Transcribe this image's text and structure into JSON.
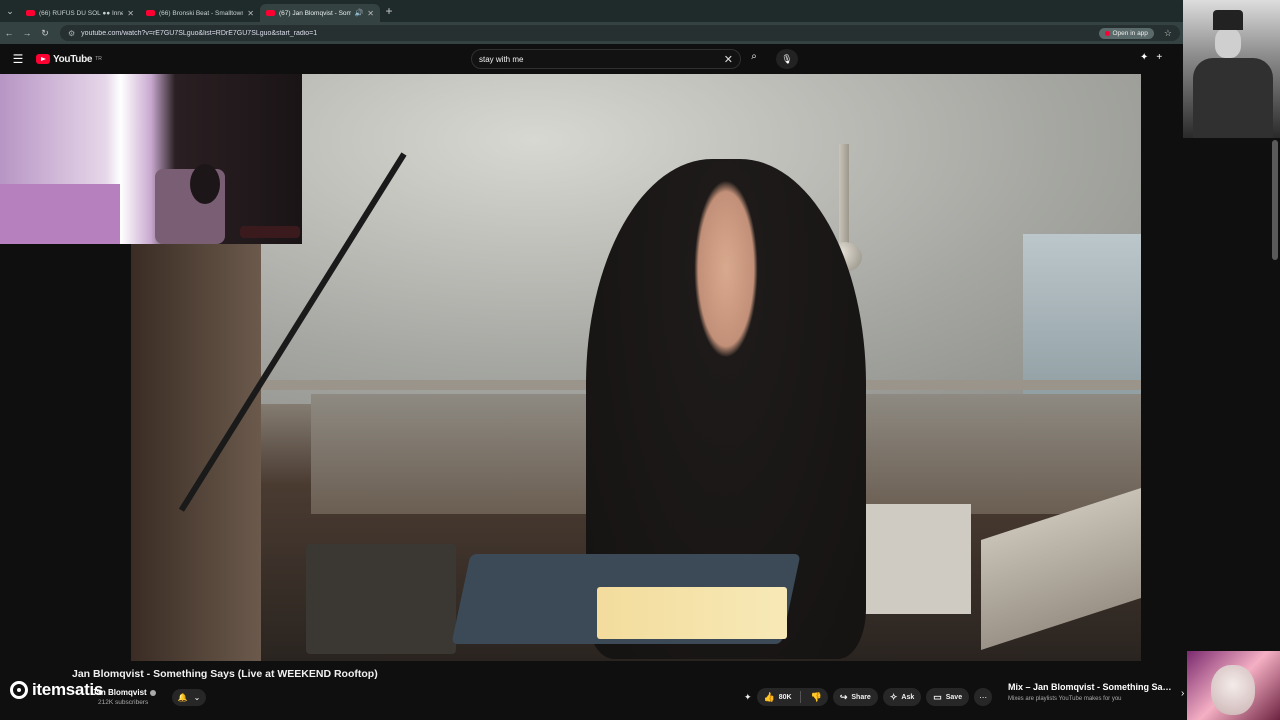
{
  "browser": {
    "tabs": [
      {
        "title": "(66) RÜFÜS DU SOL ●● Innerbloom",
        "active": false
      },
      {
        "title": "(66) Bronski Beat - Smalltown Boy",
        "active": false
      },
      {
        "title": "(67) Jan Blomqvist - Something Says",
        "active": true
      }
    ],
    "url": "youtube.com/watch?v=rE7GU7SLguo&list=RDrE7GU7SLguo&start_radio=1",
    "open_in_app_label": "Open in app"
  },
  "youtube": {
    "logo_text": "YouTube",
    "country_code": "TR",
    "search_query": "stay with me"
  },
  "video": {
    "title": "Jan Blomqvist - Something Says (Live at WEEKEND Rooftop)",
    "channel_name": "Jan Blomqvist",
    "subscribers": "212K subscribers",
    "likes": "80K",
    "share_label": "Share",
    "ask_label": "Ask",
    "save_label": "Save"
  },
  "watermark": {
    "text": "itemsatis"
  },
  "mix": {
    "title": "Mix – Jan Blomqvist - Something Says (Live at WEEKEND Rooftop)",
    "subtitle": "Mixes are playlists YouTube makes for you"
  },
  "colors": {
    "brand_red": "#ff0033",
    "background": "#0f0f0f",
    "chrome_tab_strip": "#1f2a2a"
  }
}
